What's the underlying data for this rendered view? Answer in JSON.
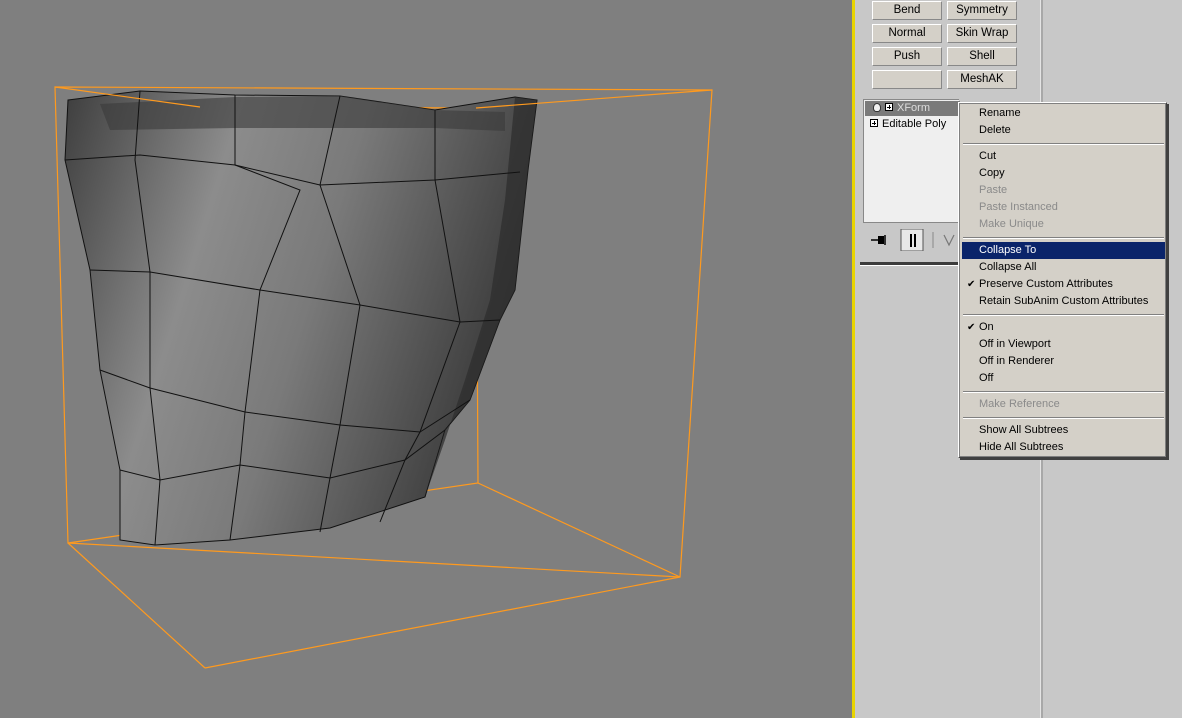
{
  "modifier_buttons": [
    "Bend",
    "Symmetry",
    "Normal",
    "Skin Wrap",
    "Push",
    "Shell",
    "",
    "MeshAK"
  ],
  "stack": {
    "items": [
      {
        "label": "XForm",
        "selected": true
      },
      {
        "label": "Editable Poly",
        "selected": false
      }
    ]
  },
  "context_menu": {
    "groups": [
      [
        {
          "label": "Rename",
          "enabled": true
        },
        {
          "label": "Delete",
          "enabled": true
        }
      ],
      [
        {
          "label": "Cut",
          "enabled": true
        },
        {
          "label": "Copy",
          "enabled": true
        },
        {
          "label": "Paste",
          "enabled": false
        },
        {
          "label": "Paste Instanced",
          "enabled": false
        },
        {
          "label": "Make Unique",
          "enabled": false
        }
      ],
      [
        {
          "label": "Collapse To",
          "enabled": true,
          "highlighted": true
        },
        {
          "label": "Collapse All",
          "enabled": true
        },
        {
          "label": "Preserve Custom Attributes",
          "enabled": true,
          "checked": true
        },
        {
          "label": "Retain SubAnim Custom Attributes",
          "enabled": true
        }
      ],
      [
        {
          "label": "On",
          "enabled": true,
          "checked": true
        },
        {
          "label": "Off in Viewport",
          "enabled": true
        },
        {
          "label": "Off in Renderer",
          "enabled": true
        },
        {
          "label": "Off",
          "enabled": true
        }
      ],
      [
        {
          "label": "Make Reference",
          "enabled": false
        }
      ],
      [
        {
          "label": "Show All Subtrees",
          "enabled": true
        },
        {
          "label": "Hide All Subtrees",
          "enabled": true
        }
      ]
    ]
  },
  "colors": {
    "viewport_bg": "#7f7f7f",
    "viewport_active_border": "#e8d400",
    "bounding_box": "#ff9a1e",
    "menu_highlight": "#0a246a",
    "panel_bg": "#c8c8c8"
  },
  "icons": [
    "lightbulb-icon",
    "expand-plus-icon",
    "pin-stack-icon",
    "show-end-result-icon",
    "make-unique-icon"
  ]
}
